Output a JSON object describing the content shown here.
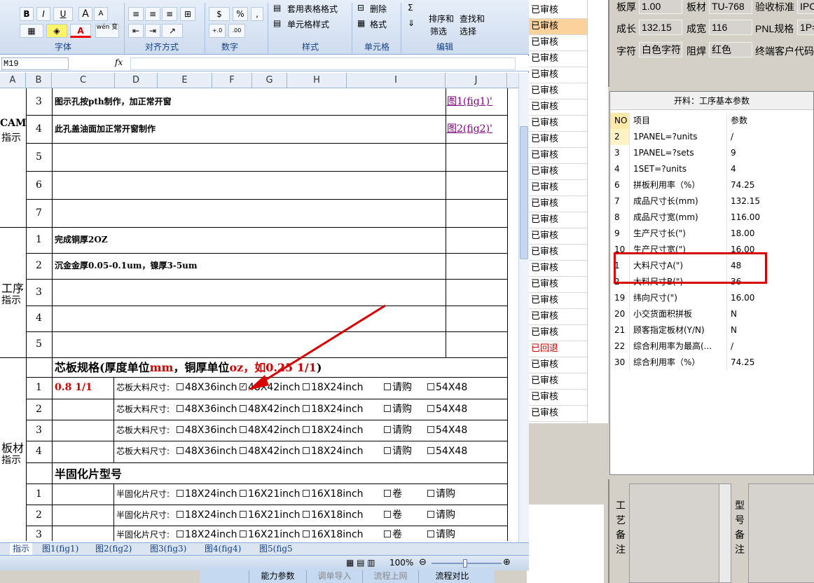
{
  "ribbon": {
    "groups": [
      "字体",
      "对齐方式",
      "数字",
      "样式",
      "单元格",
      "编辑"
    ],
    "buttons": {
      "bold": "B",
      "italic": "I",
      "underline": "U",
      "grow": "A",
      "shrink": "A",
      "percent": "%",
      "comma": ",",
      "table_format": "套用表格格式",
      "cell_style": "单元格样式",
      "delete": "删除",
      "format": "格式",
      "sort_filter_1": "排序和",
      "sort_filter_2": "筛选",
      "find_select_1": "查找和",
      "find_select_2": "选择",
      "wen": "wén 变"
    }
  },
  "formula_bar": {
    "name_box": "M19",
    "fx": "fx",
    "value": ""
  },
  "columns": [
    "A",
    "B",
    "C",
    "D",
    "E",
    "F",
    "G",
    "H",
    "I",
    "J"
  ],
  "sheet": {
    "sections": [
      {
        "label_line1": "CAM",
        "label_line2": "指示"
      },
      {
        "label_line1": "工序",
        "label_line2": "指示"
      },
      {
        "label_line1": "板材",
        "label_line2": "指示"
      }
    ],
    "cam_rows": [
      {
        "n": "3",
        "text": "图示孔按pth制作，加正常开窗",
        "link": "图1(fig1)'"
      },
      {
        "n": "4",
        "text": "此孔盖油面加正常开窗制作",
        "link": "图2(fig2)'"
      },
      {
        "n": "5",
        "text": "",
        "link": ""
      },
      {
        "n": "6",
        "text": "",
        "link": ""
      },
      {
        "n": "7",
        "text": "",
        "link": ""
      }
    ],
    "process_rows": [
      {
        "n": "1",
        "text": "完成铜厚2OZ"
      },
      {
        "n": "2",
        "text": "沉金金厚0.05-0.1um，镍厚3-5um"
      },
      {
        "n": "3",
        "text": ""
      },
      {
        "n": "4",
        "text": ""
      },
      {
        "n": "5",
        "text": ""
      }
    ],
    "core_title_a": "芯板规格(厚度单位",
    "core_title_mm": "mm",
    "core_title_b": "，铜厚单位",
    "core_title_oz": "oz，如0.25 1/1",
    "core_title_c": ")",
    "core_rows": [
      {
        "n": "1",
        "spec": "0.8 1/1",
        "label": "芯板大料尺寸:",
        "o1": "48X36inch",
        "o2": "48X42inch",
        "o3": "18X24inch",
        "o4": "请购",
        "o5": "54X48",
        "checked": 2
      },
      {
        "n": "2",
        "spec": "",
        "label": "芯板大料尺寸:",
        "o1": "48X36inch",
        "o2": "48X42inch",
        "o3": "18X24inch",
        "o4": "请购",
        "o5": "54X48",
        "checked": 0
      },
      {
        "n": "3",
        "spec": "",
        "label": "芯板大料尺寸:",
        "o1": "48X36inch",
        "o2": "48X42inch",
        "o3": "18X24inch",
        "o4": "请购",
        "o5": "54X48",
        "checked": 0
      },
      {
        "n": "4",
        "spec": "",
        "label": "芯板大料尺寸:",
        "o1": "48X36inch",
        "o2": "48X42inch",
        "o3": "18X24inch",
        "o4": "请购",
        "o5": "54X48",
        "checked": 0
      }
    ],
    "prepreg_title": "半固化片型号",
    "prepreg_rows": [
      {
        "n": "1",
        "label": "半固化片尺寸:",
        "o1": "18X24inch",
        "o2": "16X21inch",
        "o3": "16X18inch",
        "o4": "卷",
        "o5": "请购"
      },
      {
        "n": "2",
        "label": "半固化片尺寸:",
        "o1": "18X24inch",
        "o2": "16X21inch",
        "o3": "16X18inch",
        "o4": "卷",
        "o5": "请购"
      },
      {
        "n": "3",
        "label": "半固化片尺寸:",
        "o1": "18X24inch",
        "o2": "16X21inch",
        "o3": "16X18inch",
        "o4": "卷",
        "o5": "请购"
      }
    ]
  },
  "sheet_tabs": [
    "指示",
    "图1(fig1)",
    "图2(fig2)",
    "图3(fig3)",
    "图4(fig4)",
    "图5(fig5"
  ],
  "status_bar": {
    "zoom": "100%"
  },
  "status_col": [
    "已审核",
    "已审核",
    "已审核",
    "已审核",
    "已审核",
    "已审核",
    "已审核",
    "已审核",
    "已审核",
    "已审核",
    "已审核",
    "已审核",
    "已审核",
    "已审核",
    "已审核",
    "已审核",
    "已审核",
    "已审核",
    "已审核",
    "已审核",
    "已审核",
    "已回退",
    "已审核",
    "已审核",
    "已审核",
    "已审核"
  ],
  "info": {
    "thickness_label": "板厚",
    "thickness": "1.00",
    "material_label": "板材",
    "material": "TU-768",
    "standard_label": "验收标准",
    "standard": "IPC",
    "length_label": "成长",
    "length": "132.15",
    "width_label": "成宽",
    "width": "116",
    "pnl_label": "PNL规格",
    "pnl": "1P=",
    "char_label": "字符",
    "char": "白色字符",
    "mask_label": "阻焊",
    "mask": "红色",
    "customer_label": "终端客户代码"
  },
  "params": {
    "title": "开料：工序基本参数",
    "header": {
      "no": "NO",
      "item": "项目",
      "val": "参数"
    },
    "rows": [
      {
        "no": "2",
        "item": "1PANEL=?units",
        "val": "/"
      },
      {
        "no": "3",
        "item": "1PANEL=?sets",
        "val": "9"
      },
      {
        "no": "4",
        "item": "1SET=?units",
        "val": "4"
      },
      {
        "no": "6",
        "item": "拼板利用率（%）",
        "val": "74.25"
      },
      {
        "no": "7",
        "item": "成品尺寸长(mm)",
        "val": "132.15"
      },
      {
        "no": "8",
        "item": "成品尺寸宽(mm)",
        "val": "116.00"
      },
      {
        "no": "9",
        "item": "生产尺寸长(\")",
        "val": "18.00"
      },
      {
        "no": "10",
        "item": "生产尺寸宽(\")",
        "val": "16.00"
      },
      {
        "no": "1",
        "item": "大料尺寸A(\")",
        "val": "48"
      },
      {
        "no": "2",
        "item": "大料尺寸B(\")",
        "val": "36"
      },
      {
        "no": "19",
        "item": "纬向尺寸(\")",
        "val": "16.00"
      },
      {
        "no": "20",
        "item": "小交货面积拼板",
        "val": "N"
      },
      {
        "no": "21",
        "item": "顾客指定板材(Y/N)",
        "val": "N"
      },
      {
        "no": "22",
        "item": "综合利用率为最高(...",
        "val": "/"
      },
      {
        "no": "30",
        "item": "综合利用率（%）",
        "val": "74.25"
      }
    ]
  },
  "memo": {
    "process_memo": "工艺备注",
    "model_memo": "型号备注"
  },
  "bottom_buttons": [
    "能力参数",
    "调单导入",
    "流程上网",
    "流程对比"
  ],
  "colors": {
    "selected_status": "#fcd29c",
    "highlight_box": "#d80000",
    "link": "#800080"
  }
}
